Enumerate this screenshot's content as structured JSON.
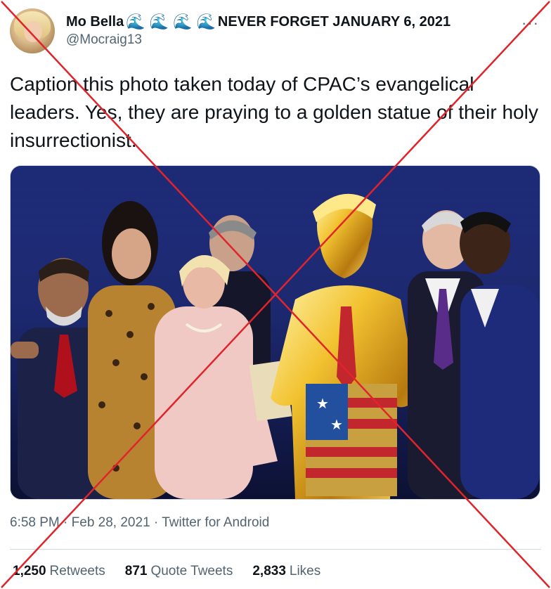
{
  "tweet": {
    "display_name": "Mo Bella",
    "name_emoji": "🌊",
    "name_suffix": "NEVER FORGET JANUARY 6, 2021",
    "handle": "@Mocraig13",
    "more_label": "···",
    "text": "Caption this photo taken today of CPAC’s evangelical leaders. Yes, they are praying to a golden statue of their holy insurrectionist.",
    "time": "6:58 PM",
    "date": "Feb 28, 2021",
    "source": "Twitter for Android",
    "separator": "·"
  },
  "stats": {
    "retweets": {
      "count": "1,250",
      "label": "Retweets"
    },
    "quotes": {
      "count": "871",
      "label": "Quote Tweets"
    },
    "likes": {
      "count": "2,833",
      "label": "Likes"
    }
  },
  "overlay": {
    "type": "red-x",
    "color": "#e0242b"
  },
  "colors": {
    "accent": "#1d9bf0",
    "muted": "#536471",
    "text": "#0f1419"
  }
}
